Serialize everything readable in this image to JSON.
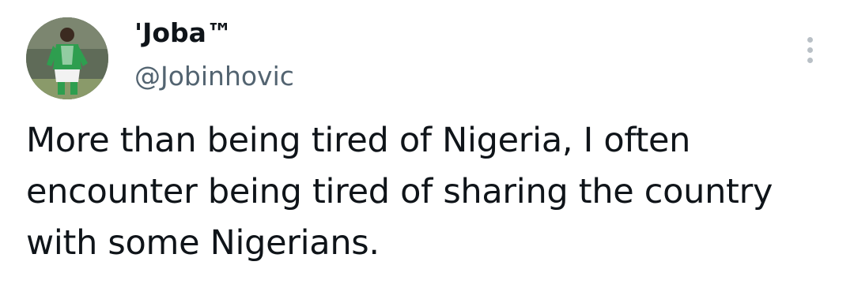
{
  "tweet": {
    "author": {
      "display_name": "'Joba™",
      "handle": "@Jobinhovic",
      "avatar_icon": "avatar-photo-footballer-green-kit"
    },
    "more_icon": "more-vertical-icon",
    "text": "More than being tired of Nigeria, I often encounter being tired of sharing the country with some Nigerians."
  },
  "colors": {
    "text": "#0f1419",
    "secondary_text": "#536471",
    "menu_dots": "#b9c0c6",
    "background": "#ffffff"
  }
}
